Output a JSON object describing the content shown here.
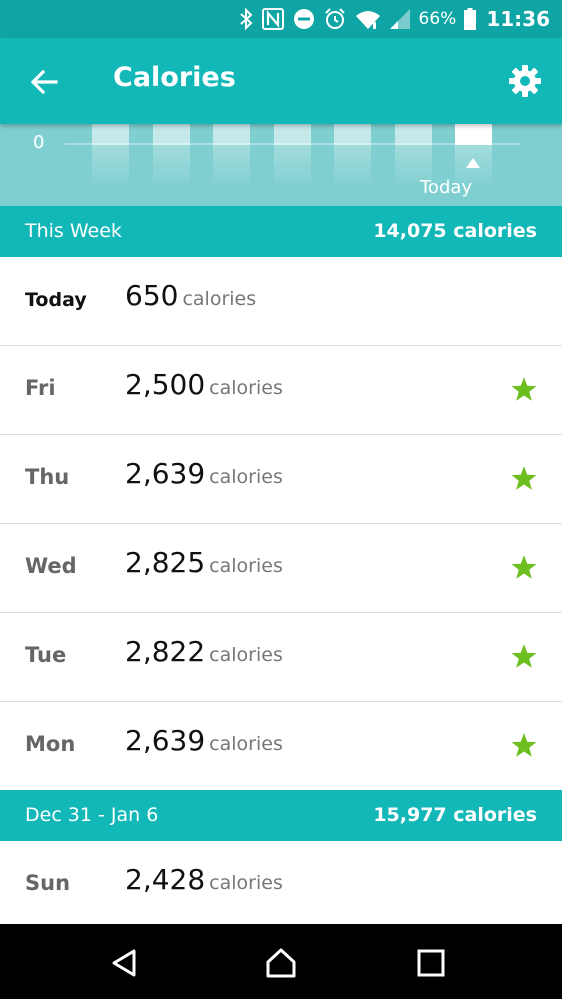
{
  "status_bar": {
    "battery_percent": "66%",
    "time": "11:36",
    "icons": [
      "bluetooth-icon",
      "nfc-icon",
      "do-not-disturb-icon",
      "alarm-icon",
      "wifi-icon",
      "signal-icon",
      "battery-icon"
    ]
  },
  "app_bar": {
    "title": "Calories",
    "back_icon": "arrow-left-icon",
    "settings_icon": "gear-icon"
  },
  "chart": {
    "zero_label": "0",
    "today_label": "Today",
    "bar_count": 7
  },
  "sections": [
    {
      "label": "This Week",
      "total": "14,075 calories",
      "rows": [
        {
          "day": "Today",
          "value": "650",
          "unit": "calories",
          "goal_met": false
        },
        {
          "day": "Fri",
          "value": "2,500",
          "unit": "calories",
          "goal_met": true
        },
        {
          "day": "Thu",
          "value": "2,639",
          "unit": "calories",
          "goal_met": true
        },
        {
          "day": "Wed",
          "value": "2,825",
          "unit": "calories",
          "goal_met": true
        },
        {
          "day": "Tue",
          "value": "2,822",
          "unit": "calories",
          "goal_met": true
        },
        {
          "day": "Mon",
          "value": "2,639",
          "unit": "calories",
          "goal_met": true
        }
      ]
    },
    {
      "label": "Dec 31 - Jan 6",
      "total": "15,977 calories",
      "rows": [
        {
          "day": "Sun",
          "value": "2,428",
          "unit": "calories",
          "goal_met": false
        }
      ]
    }
  ],
  "colors": {
    "status_bar": "#0fa5a5",
    "app_bar": "#12b7b7",
    "chart_bg": "#7fcfd0",
    "star": "#6cbf1f"
  },
  "nav_bar": {
    "icons": [
      "back-triangle-icon",
      "home-icon",
      "recents-icon"
    ]
  }
}
